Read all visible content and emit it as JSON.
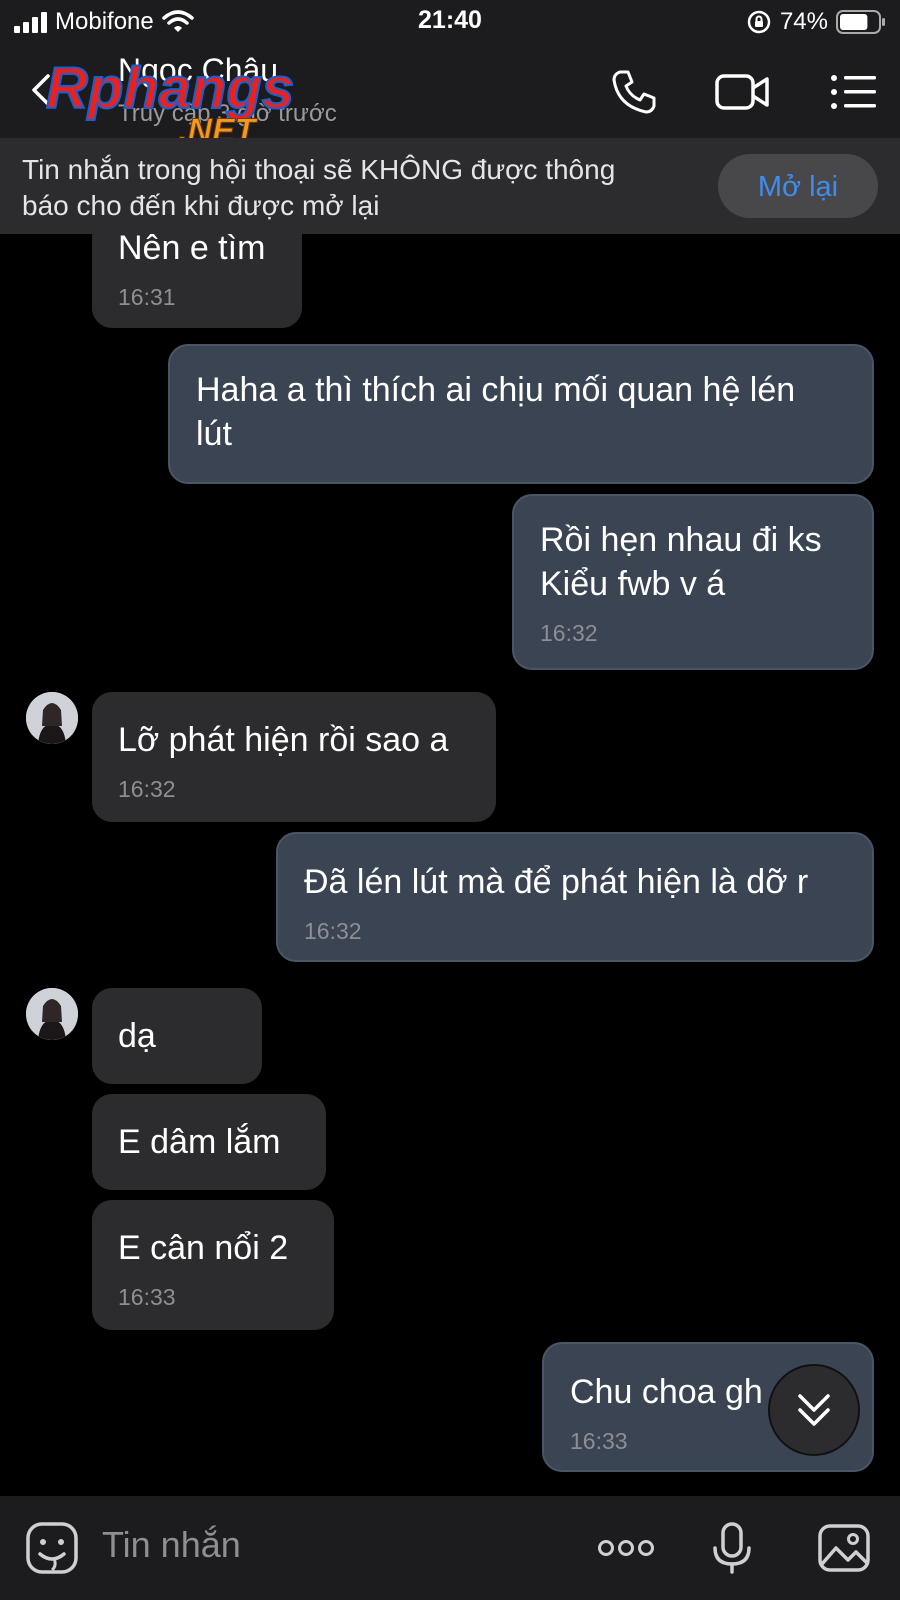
{
  "status_bar": {
    "carrier": "Mobifone",
    "time": "21:40",
    "battery": "74%",
    "battery_level": 0.74
  },
  "header": {
    "contact_name": "Ngọc Châu",
    "last_seen": "Truy cập 3 giờ trước",
    "watermark": "Rphangs .NET",
    "icons": [
      "back-icon",
      "phone-icon",
      "video-call-icon",
      "menu-list-icon"
    ]
  },
  "banner": {
    "line1": "Tin nhắn trong hội thoại sẽ KHÔNG được thông",
    "line2": "báo cho đến khi được mở lại",
    "button": "Mở lại",
    "accent": "#3e8cf0"
  },
  "messages": [
    {
      "dir": "in",
      "lines": [
        "Nên e tìm"
      ],
      "time": "16:31"
    },
    {
      "dir": "out",
      "lines": [
        "Haha a thì thích ai chịu mối quan hệ lén",
        "lút"
      ],
      "time": ""
    },
    {
      "dir": "out",
      "lines": [
        "Rồi hẹn nhau đi ks",
        "Kiểu fwb v á"
      ],
      "time": "16:32"
    },
    {
      "dir": "in",
      "lines": [
        "Lỡ phát hiện rồi sao a"
      ],
      "time": "16:32"
    },
    {
      "dir": "out",
      "lines": [
        "Đã lén lút mà để phát hiện là dỡ r"
      ],
      "time": "16:32"
    },
    {
      "dir": "in",
      "lines": [
        "dạ"
      ],
      "time": ""
    },
    {
      "dir": "in",
      "lines": [
        "E dâm lắm"
      ],
      "time": ""
    },
    {
      "dir": "in",
      "lines": [
        "E cân nổi 2"
      ],
      "time": "16:33"
    },
    {
      "dir": "out",
      "lines": [
        "Chu choa gh"
      ],
      "time": "16:33"
    }
  ],
  "composer": {
    "placeholder": "Tin nhắn",
    "icons": [
      "sticker-icon",
      "more-icon",
      "microphone-icon",
      "image-icon"
    ]
  }
}
